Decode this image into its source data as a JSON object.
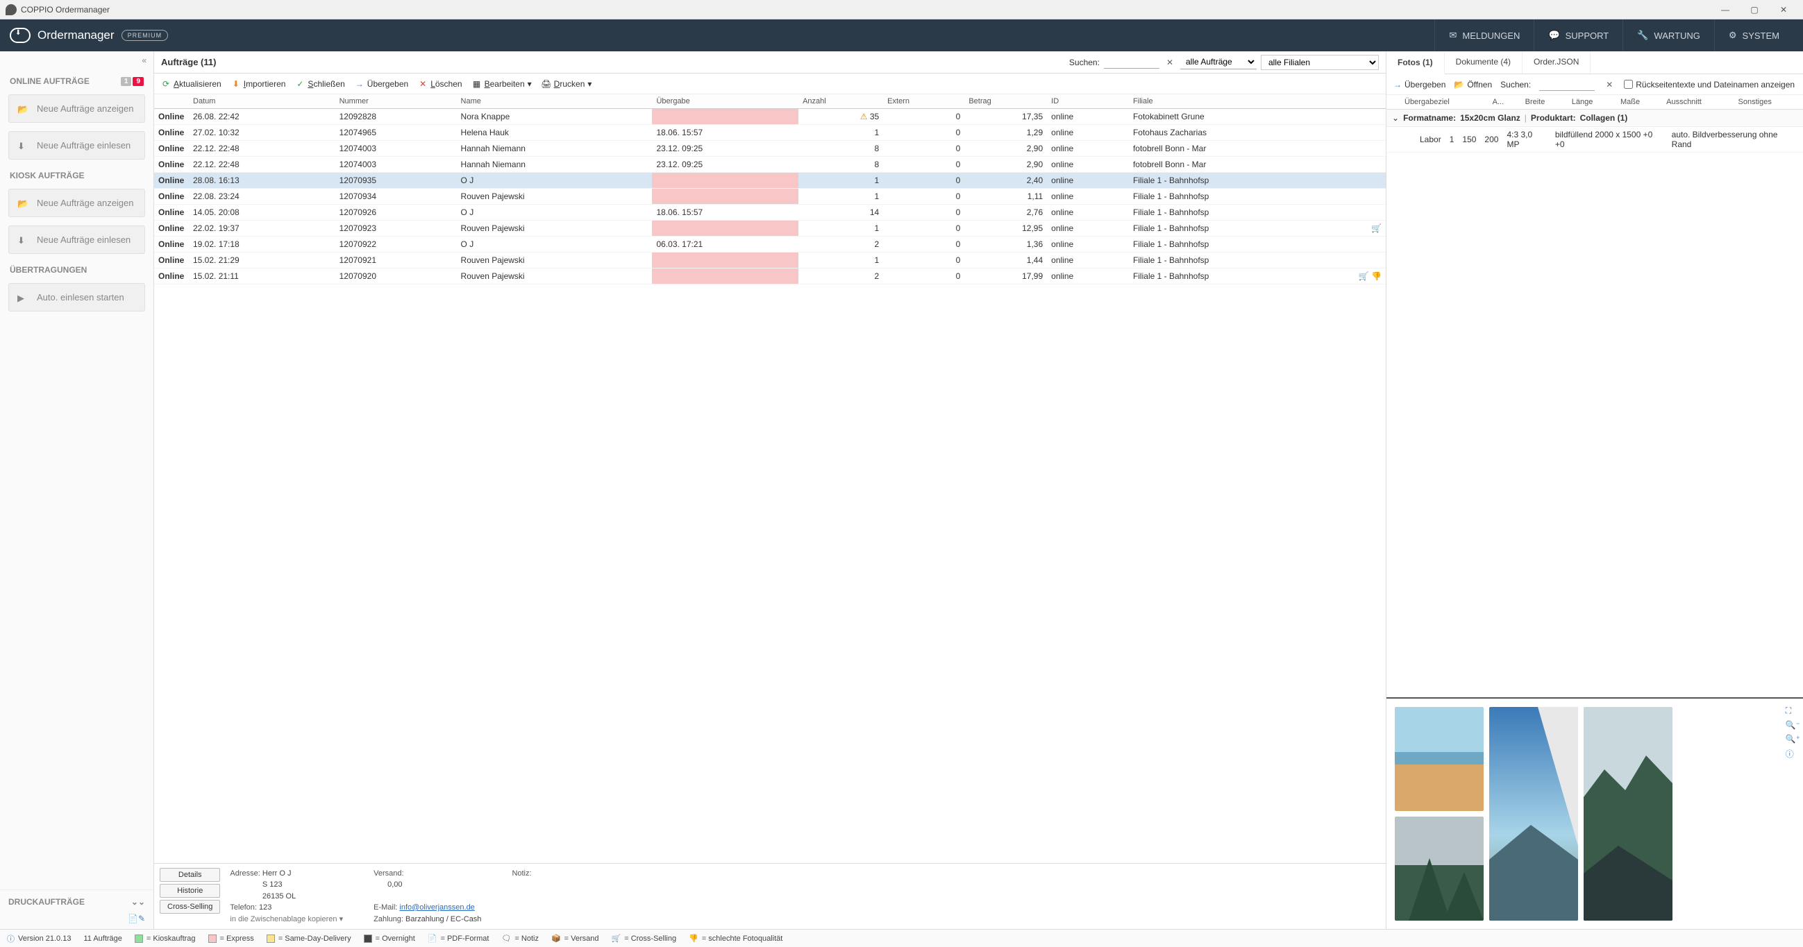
{
  "window": {
    "title": "COPPIO Ordermanager"
  },
  "appbar": {
    "title": "Ordermanager",
    "premium": "PREMIUM",
    "buttons": {
      "meldungen": "MELDUNGEN",
      "support": "SUPPORT",
      "wartung": "WARTUNG",
      "system": "SYSTEM"
    }
  },
  "sidebar": {
    "online_title": "ONLINE AUFTRÄGE",
    "badge1": "1",
    "badge9": "9",
    "btn_anzeigen": "Neue Aufträge anzeigen",
    "btn_einlesen": "Neue Aufträge einlesen",
    "kiosk_title": "KIOSK AUFTRÄGE",
    "ubertr_title": "ÜBERTRAGUNGEN",
    "btn_auto": "Auto. einlesen starten",
    "druck_title": "DRUCKAUFTRÄGE"
  },
  "top": {
    "title": "Aufträge (11)",
    "search_label": "Suchen:",
    "filter_all": "alle Aufträge",
    "filter_filiale": "alle Filialen"
  },
  "toolbar": {
    "aktualisieren": "Aktualisieren",
    "importieren": "Importieren",
    "schliessen": "Schließen",
    "uebergeben": "Übergeben",
    "loeschen": "Löschen",
    "bearbeiten": "Bearbeiten",
    "drucken": "Drucken"
  },
  "cols": {
    "datum": "Datum",
    "nummer": "Nummer",
    "name": "Name",
    "uebergabe": "Übergabe",
    "anzahl": "Anzahl",
    "extern": "Extern",
    "betrag": "Betrag",
    "id": "ID",
    "filiale": "Filiale"
  },
  "rows": [
    {
      "datum": "26.08. 22:42",
      "nr": "12092828",
      "name": "Nora Knappe",
      "uebergabe": "",
      "pink": true,
      "warn": true,
      "anzahl": "35",
      "extern": "0",
      "betrag": "17,35",
      "id": "online",
      "filiale": "Fotokabinett Grune"
    },
    {
      "datum": "27.02. 10:32",
      "nr": "12074965",
      "name": "Helena Hauk",
      "uebergabe": "18.06. 15:57",
      "pink": false,
      "anzahl": "1",
      "extern": "0",
      "betrag": "1,29",
      "id": "online",
      "filiale": "Fotohaus Zacharias"
    },
    {
      "datum": "22.12. 22:48",
      "nr": "12074003",
      "name": "Hannah Niemann",
      "uebergabe": "23.12. 09:25",
      "pink": false,
      "anzahl": "8",
      "extern": "0",
      "betrag": "2,90",
      "id": "online",
      "filiale": "fotobrell Bonn - Mar"
    },
    {
      "datum": "22.12. 22:48",
      "nr": "12074003",
      "name": "Hannah Niemann",
      "uebergabe": "23.12. 09:25",
      "pink": false,
      "anzahl": "8",
      "extern": "0",
      "betrag": "2,90",
      "id": "online",
      "filiale": "fotobrell Bonn - Mar"
    },
    {
      "datum": "28.08. 16:13",
      "nr": "12070935",
      "name": "O J",
      "uebergabe": "",
      "pink": true,
      "anzahl": "1",
      "extern": "0",
      "betrag": "2,40",
      "id": "online",
      "filiale": "Filiale 1 - Bahnhofsp",
      "selected": true
    },
    {
      "datum": "22.08. 23:24",
      "nr": "12070934",
      "name": "Rouven Pajewski",
      "uebergabe": "",
      "pink": true,
      "anzahl": "1",
      "extern": "0",
      "betrag": "1,11",
      "id": "online",
      "filiale": "Filiale 1 - Bahnhofsp"
    },
    {
      "datum": "14.05. 20:08",
      "nr": "12070926",
      "name": "O J",
      "uebergabe": "18.06. 15:57",
      "pink": false,
      "anzahl": "14",
      "extern": "0",
      "betrag": "2,76",
      "id": "online",
      "filiale": "Filiale 1 - Bahnhofsp"
    },
    {
      "datum": "22.02. 19:37",
      "nr": "12070923",
      "name": "Rouven Pajewski",
      "uebergabe": "",
      "pink": true,
      "anzahl": "1",
      "extern": "0",
      "betrag": "12,95",
      "id": "online",
      "filiale": "Filiale 1 - Bahnhofsp",
      "cart": true
    },
    {
      "datum": "19.02. 17:18",
      "nr": "12070922",
      "name": "O J",
      "uebergabe": "06.03. 17:21",
      "pink": false,
      "anzahl": "2",
      "extern": "0",
      "betrag": "1,36",
      "id": "online",
      "filiale": "Filiale 1 - Bahnhofsp"
    },
    {
      "datum": "15.02. 21:29",
      "nr": "12070921",
      "name": "Rouven Pajewski",
      "uebergabe": "",
      "pink": true,
      "anzahl": "1",
      "extern": "0",
      "betrag": "1,44",
      "id": "online",
      "filiale": "Filiale 1 - Bahnhofsp"
    },
    {
      "datum": "15.02. 21:11",
      "nr": "12070920",
      "name": "Rouven Pajewski",
      "uebergabe": "",
      "pink": true,
      "anzahl": "2",
      "extern": "0",
      "betrag": "17,99",
      "id": "online",
      "filiale": "Filiale 1 - Bahnhofsp",
      "cart": true,
      "thumbsdown": true
    }
  ],
  "details": {
    "btn_details": "Details",
    "btn_historie": "Historie",
    "btn_cross": "Cross-Selling",
    "lab_adresse": "Adresse:",
    "addr1": "Herr O J",
    "addr2": "S 123",
    "addr3": "26135 OL",
    "lab_telefon": "Telefon:",
    "telefon": "123",
    "copy": "in die Zwischenablage kopieren",
    "lab_versand": "Versand:",
    "versand": "0,00",
    "lab_email": "E-Mail:",
    "email": "info@oliverjanssen.de",
    "lab_zahlung": "Zahlung:",
    "zahlung": "Barzahlung / EC-Cash",
    "lab_notiz": "Notiz:"
  },
  "right": {
    "tab_fotos": "Fotos (1)",
    "tab_dok": "Dokumente (4)",
    "tab_json": "Order.JSON",
    "tb_ueber": "Übergeben",
    "tb_oeffnen": "Öffnen",
    "tb_suchen": "Suchen:",
    "chk_label": "Rückseitentexte und Dateinamen anzeigen",
    "hcol": {
      "ziel": "Übergabeziel",
      "a": "A...",
      "breite": "Breite",
      "laenge": "Länge",
      "masse": "Maße",
      "ausschnitt": "Ausschnitt",
      "sonstiges": "Sonstiges"
    },
    "format_label": "Formatname:",
    "format_val": "15x20cm  Glanz",
    "produkt_label": "Produktart:",
    "produkt_val": "Collagen (1)",
    "row": {
      "ziel": "Labor",
      "a": "1",
      "breite": "150",
      "laenge": "200",
      "masse": "4:3  3,0 MP",
      "ausschnitt": "bildfüllend  2000 x 1500 +0 +0",
      "sonstiges": "auto. Bildverbesserung  ohne Rand"
    }
  },
  "status": {
    "version": "Version 21.0.13",
    "count": "11 Aufträge",
    "leg": {
      "kiosk": "= Kioskauftrag",
      "express": "= Express",
      "same": "= Same-Day-Delivery",
      "over": "= Overnight",
      "pdf": "= PDF-Format",
      "notiz": "= Notiz",
      "versand": "= Versand",
      "cross": "= Cross-Selling",
      "schlecht": "= schlechte Fotoqualität"
    }
  }
}
